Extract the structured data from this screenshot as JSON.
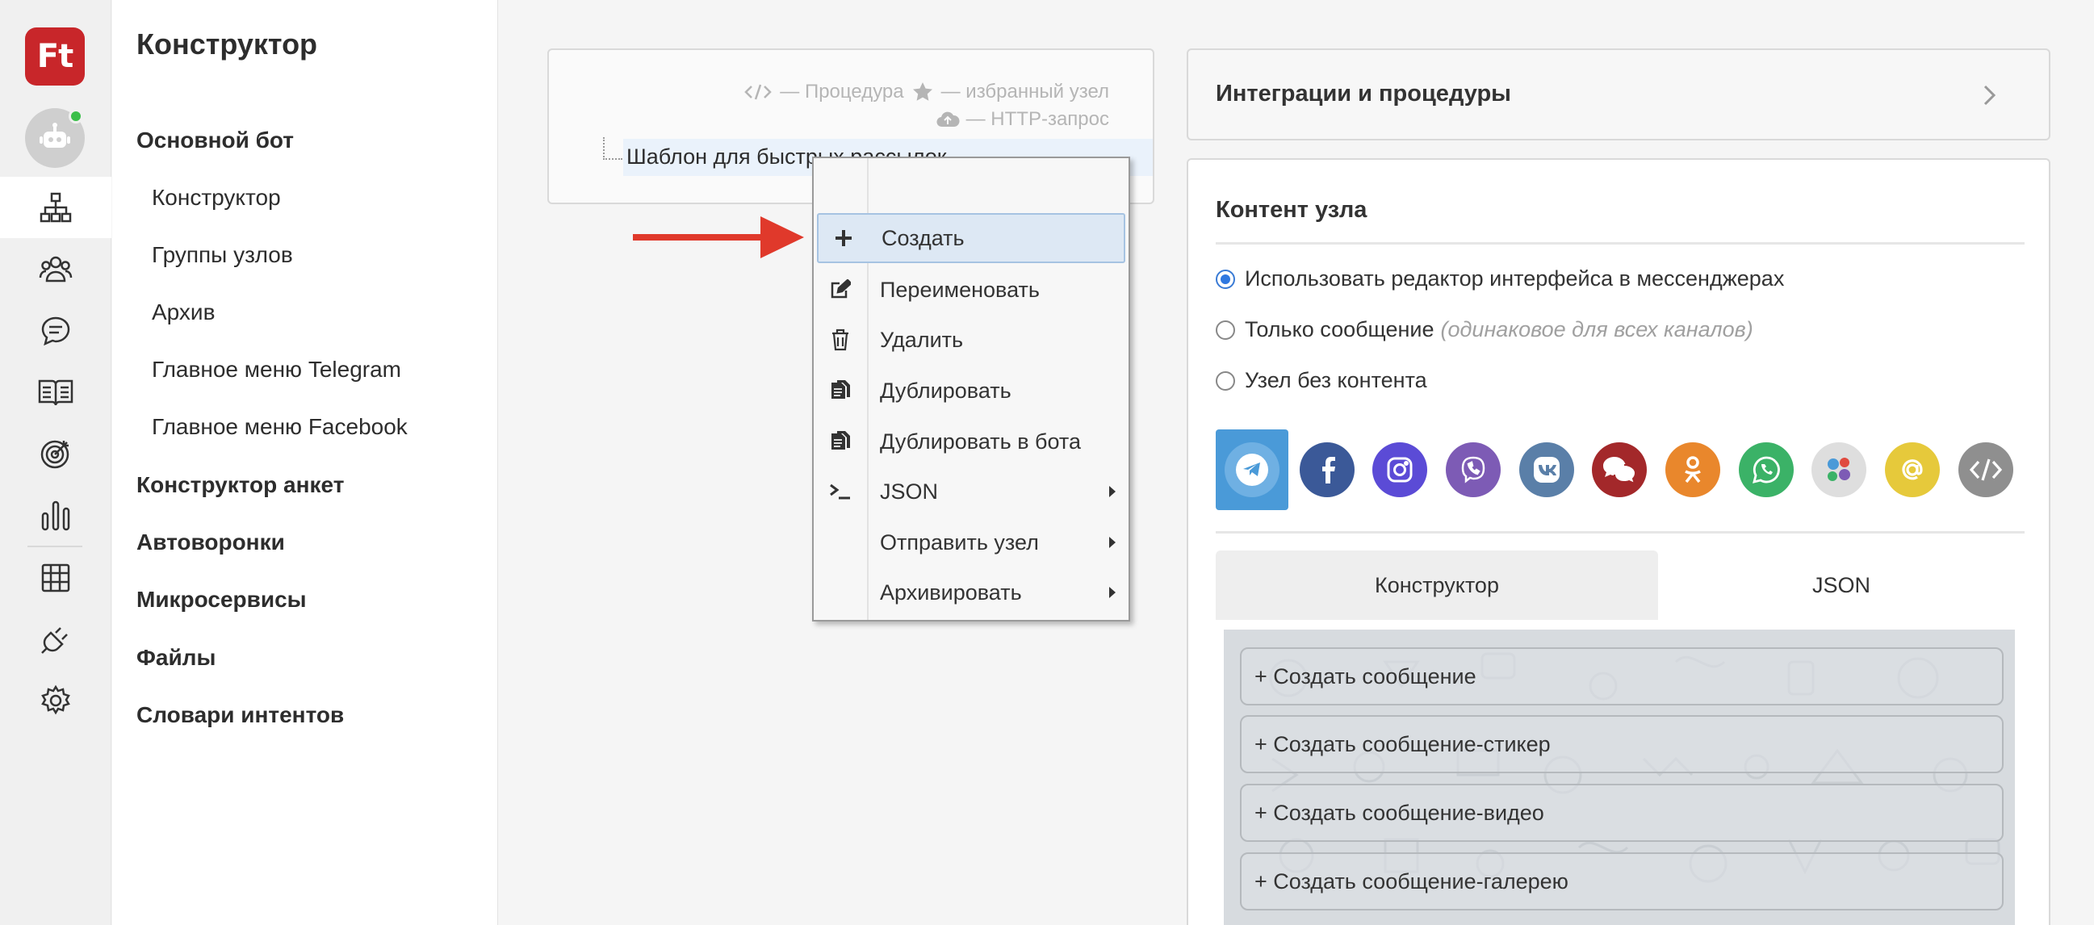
{
  "app": {
    "logo_text": "Ft"
  },
  "rail": {
    "items": [
      {
        "icon": "sitemap-icon",
        "active": true
      },
      {
        "icon": "users-group-icon"
      },
      {
        "icon": "chat-icon"
      },
      {
        "icon": "book-icon"
      },
      {
        "icon": "target-icon"
      },
      {
        "icon": "bar-chart-icon"
      },
      {
        "icon": "table-icon"
      },
      {
        "icon": "plug-icon"
      },
      {
        "icon": "gear-icon"
      }
    ]
  },
  "menu": {
    "title": "Конструктор",
    "items": [
      {
        "label": "Основной бот",
        "level": "top"
      },
      {
        "label": "Конструктор",
        "level": "sub"
      },
      {
        "label": "Группы узлов",
        "level": "sub"
      },
      {
        "label": "Архив",
        "level": "sub"
      },
      {
        "label": "Главное меню Telegram",
        "level": "sub"
      },
      {
        "label": "Главное меню Facebook",
        "level": "sub"
      },
      {
        "label": "Конструктор анкет",
        "level": "top"
      },
      {
        "label": "Автоворонки",
        "level": "top"
      },
      {
        "label": "Микросервисы",
        "level": "top"
      },
      {
        "label": "Файлы",
        "level": "top"
      },
      {
        "label": "Словари интентов",
        "level": "top"
      }
    ]
  },
  "tree": {
    "legend_procedure": "— Процедура",
    "legend_favorite": "— избранный узел",
    "legend_http": "— HTTP-запрос",
    "node_label": "Шаблон для быстрых рассылок"
  },
  "context_menu": {
    "items": [
      {
        "label": "Создать",
        "icon": "plus-icon",
        "highlighted": true
      },
      {
        "label": "Переименовать",
        "icon": "edit-icon"
      },
      {
        "label": "Удалить",
        "icon": "trash-icon"
      },
      {
        "label": "Дублировать",
        "icon": "duplicate-icon"
      },
      {
        "label": "Дублировать в бота",
        "icon": "duplicate-icon"
      },
      {
        "label": "JSON",
        "icon": "terminal-icon",
        "submenu": true
      },
      {
        "label": "Отправить узел",
        "submenu": true
      },
      {
        "label": "Архивировать",
        "submenu": true
      }
    ]
  },
  "integrations": {
    "title": "Интеграции и процедуры"
  },
  "node_content": {
    "title": "Контент узла",
    "options": [
      {
        "label": "Использовать редактор интерфейса в мессенджерах",
        "hint": "",
        "checked": true
      },
      {
        "label": "Только сообщение",
        "hint": "(одинаковое для всех каналов)",
        "checked": false
      },
      {
        "label": "Узел без контента",
        "hint": "",
        "checked": false
      }
    ],
    "channels": [
      {
        "name": "telegram",
        "color": "#4a9ad8",
        "active": true
      },
      {
        "name": "facebook",
        "color": "#3b5998"
      },
      {
        "name": "instagram",
        "color": "#5b4bd6"
      },
      {
        "name": "viber",
        "color": "#7d5bb5"
      },
      {
        "name": "vk",
        "color": "#5a7fa8"
      },
      {
        "name": "livechat",
        "color": "#a3282a"
      },
      {
        "name": "odnoklassniki",
        "color": "#e9872c"
      },
      {
        "name": "whatsapp",
        "color": "#3bb267"
      },
      {
        "name": "multi",
        "color": "#dedede"
      },
      {
        "name": "email",
        "color": "#e6c93b"
      },
      {
        "name": "code",
        "color": "#8f8f8f"
      }
    ],
    "tabs": [
      "Конструктор",
      "JSON"
    ],
    "editor_buttons": [
      "+ Создать сообщение",
      "+ Создать сообщение-стикер",
      "+ Создать сообщение-видео",
      "+ Создать сообщение-галерею"
    ]
  }
}
